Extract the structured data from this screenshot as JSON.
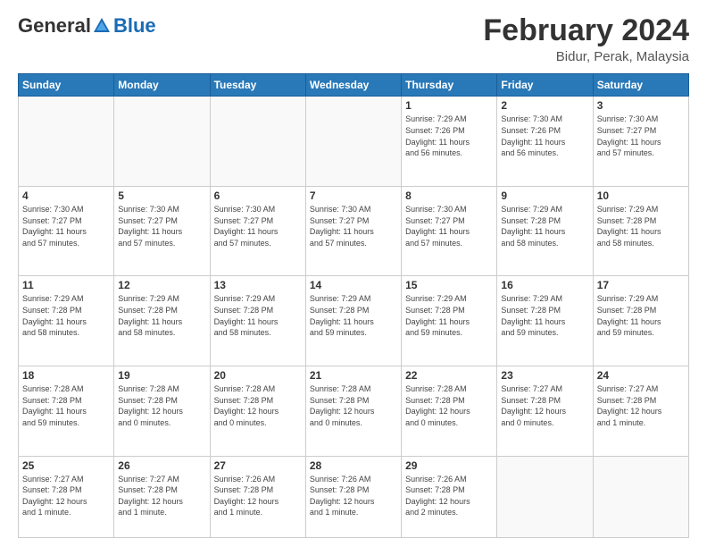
{
  "header": {
    "logo": {
      "general": "General",
      "blue": "Blue"
    },
    "title": "February 2024",
    "subtitle": "Bidur, Perak, Malaysia"
  },
  "calendar": {
    "days_of_week": [
      "Sunday",
      "Monday",
      "Tuesday",
      "Wednesday",
      "Thursday",
      "Friday",
      "Saturday"
    ],
    "weeks": [
      [
        {
          "day": "",
          "detail": ""
        },
        {
          "day": "",
          "detail": ""
        },
        {
          "day": "",
          "detail": ""
        },
        {
          "day": "",
          "detail": ""
        },
        {
          "day": "1",
          "detail": "Sunrise: 7:29 AM\nSunset: 7:26 PM\nDaylight: 11 hours\nand 56 minutes."
        },
        {
          "day": "2",
          "detail": "Sunrise: 7:30 AM\nSunset: 7:26 PM\nDaylight: 11 hours\nand 56 minutes."
        },
        {
          "day": "3",
          "detail": "Sunrise: 7:30 AM\nSunset: 7:27 PM\nDaylight: 11 hours\nand 57 minutes."
        }
      ],
      [
        {
          "day": "4",
          "detail": "Sunrise: 7:30 AM\nSunset: 7:27 PM\nDaylight: 11 hours\nand 57 minutes."
        },
        {
          "day": "5",
          "detail": "Sunrise: 7:30 AM\nSunset: 7:27 PM\nDaylight: 11 hours\nand 57 minutes."
        },
        {
          "day": "6",
          "detail": "Sunrise: 7:30 AM\nSunset: 7:27 PM\nDaylight: 11 hours\nand 57 minutes."
        },
        {
          "day": "7",
          "detail": "Sunrise: 7:30 AM\nSunset: 7:27 PM\nDaylight: 11 hours\nand 57 minutes."
        },
        {
          "day": "8",
          "detail": "Sunrise: 7:30 AM\nSunset: 7:27 PM\nDaylight: 11 hours\nand 57 minutes."
        },
        {
          "day": "9",
          "detail": "Sunrise: 7:29 AM\nSunset: 7:28 PM\nDaylight: 11 hours\nand 58 minutes."
        },
        {
          "day": "10",
          "detail": "Sunrise: 7:29 AM\nSunset: 7:28 PM\nDaylight: 11 hours\nand 58 minutes."
        }
      ],
      [
        {
          "day": "11",
          "detail": "Sunrise: 7:29 AM\nSunset: 7:28 PM\nDaylight: 11 hours\nand 58 minutes."
        },
        {
          "day": "12",
          "detail": "Sunrise: 7:29 AM\nSunset: 7:28 PM\nDaylight: 11 hours\nand 58 minutes."
        },
        {
          "day": "13",
          "detail": "Sunrise: 7:29 AM\nSunset: 7:28 PM\nDaylight: 11 hours\nand 58 minutes."
        },
        {
          "day": "14",
          "detail": "Sunrise: 7:29 AM\nSunset: 7:28 PM\nDaylight: 11 hours\nand 59 minutes."
        },
        {
          "day": "15",
          "detail": "Sunrise: 7:29 AM\nSunset: 7:28 PM\nDaylight: 11 hours\nand 59 minutes."
        },
        {
          "day": "16",
          "detail": "Sunrise: 7:29 AM\nSunset: 7:28 PM\nDaylight: 11 hours\nand 59 minutes."
        },
        {
          "day": "17",
          "detail": "Sunrise: 7:29 AM\nSunset: 7:28 PM\nDaylight: 11 hours\nand 59 minutes."
        }
      ],
      [
        {
          "day": "18",
          "detail": "Sunrise: 7:28 AM\nSunset: 7:28 PM\nDaylight: 11 hours\nand 59 minutes."
        },
        {
          "day": "19",
          "detail": "Sunrise: 7:28 AM\nSunset: 7:28 PM\nDaylight: 12 hours\nand 0 minutes."
        },
        {
          "day": "20",
          "detail": "Sunrise: 7:28 AM\nSunset: 7:28 PM\nDaylight: 12 hours\nand 0 minutes."
        },
        {
          "day": "21",
          "detail": "Sunrise: 7:28 AM\nSunset: 7:28 PM\nDaylight: 12 hours\nand 0 minutes."
        },
        {
          "day": "22",
          "detail": "Sunrise: 7:28 AM\nSunset: 7:28 PM\nDaylight: 12 hours\nand 0 minutes."
        },
        {
          "day": "23",
          "detail": "Sunrise: 7:27 AM\nSunset: 7:28 PM\nDaylight: 12 hours\nand 0 minutes."
        },
        {
          "day": "24",
          "detail": "Sunrise: 7:27 AM\nSunset: 7:28 PM\nDaylight: 12 hours\nand 1 minute."
        }
      ],
      [
        {
          "day": "25",
          "detail": "Sunrise: 7:27 AM\nSunset: 7:28 PM\nDaylight: 12 hours\nand 1 minute."
        },
        {
          "day": "26",
          "detail": "Sunrise: 7:27 AM\nSunset: 7:28 PM\nDaylight: 12 hours\nand 1 minute."
        },
        {
          "day": "27",
          "detail": "Sunrise: 7:26 AM\nSunset: 7:28 PM\nDaylight: 12 hours\nand 1 minute."
        },
        {
          "day": "28",
          "detail": "Sunrise: 7:26 AM\nSunset: 7:28 PM\nDaylight: 12 hours\nand 1 minute."
        },
        {
          "day": "29",
          "detail": "Sunrise: 7:26 AM\nSunset: 7:28 PM\nDaylight: 12 hours\nand 2 minutes."
        },
        {
          "day": "",
          "detail": ""
        },
        {
          "day": "",
          "detail": ""
        }
      ]
    ]
  }
}
